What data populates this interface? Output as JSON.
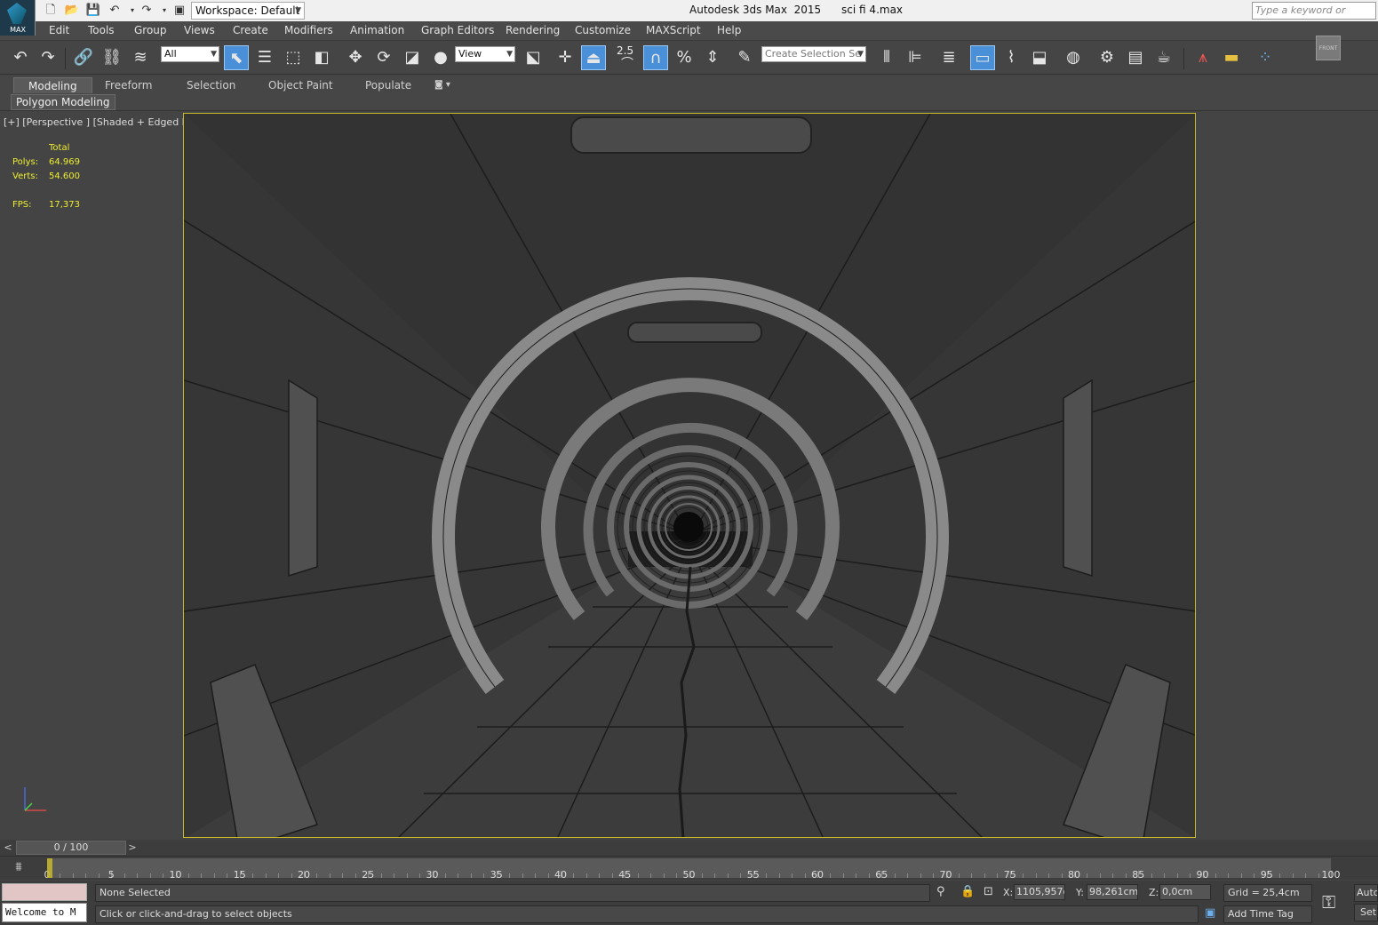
{
  "app": {
    "logo_caption": "MAX",
    "window_title": "Autodesk 3ds Max  2015      sci fi 4.max",
    "workspace_label": "Workspace: Default",
    "search_placeholder": "Type a keyword or phrase"
  },
  "menu": [
    "Edit",
    "Tools",
    "Group",
    "Views",
    "Create",
    "Modifiers",
    "Animation",
    "Graph Editors",
    "Rendering",
    "Customize",
    "MAXScript",
    "Help"
  ],
  "toolbar": {
    "selection_filter": "All",
    "reference_coord": "View",
    "named_selection_placeholder": "Create Selection Se",
    "angle_snap_label": "2.5"
  },
  "ribbon": {
    "tabs": [
      "Modeling",
      "Freeform",
      "Selection",
      "Object Paint",
      "Populate"
    ],
    "active_tab": "Modeling",
    "panel": "Polygon Modeling"
  },
  "viewport": {
    "label": "[+] [Perspective ] [Shaded + Edged Faces ]",
    "stats": {
      "header": "Total",
      "polys_label": "Polys:",
      "polys_value": "64.969",
      "verts_label": "Verts:",
      "verts_value": "54.600",
      "fps_label": "FPS:",
      "fps_value": "17,373"
    },
    "viewcube_label": "FRONT",
    "border_color": "#c8b82a",
    "stats_color": "#eeee30"
  },
  "timeline": {
    "frame_display": "0 / 100",
    "prev": "<",
    "next": ">",
    "ticks": [
      0,
      5,
      10,
      15,
      20,
      25,
      30,
      35,
      40,
      45,
      50,
      55,
      60,
      65,
      70,
      75,
      80,
      85,
      90,
      95,
      100
    ]
  },
  "status": {
    "listener_text": "Welcome to M",
    "selection_status": "None Selected",
    "prompt": "Click or click-and-drag to select objects",
    "x_label": "X:",
    "x_value": "1105,957cl",
    "y_label": "Y:",
    "y_value": "98,261cm",
    "z_label": "Z:",
    "z_value": "0,0cm",
    "grid": "Grid = 25,4cm",
    "add_time_tag": "Add Time Tag",
    "auto_key": "Auto",
    "set_key": "Set"
  }
}
